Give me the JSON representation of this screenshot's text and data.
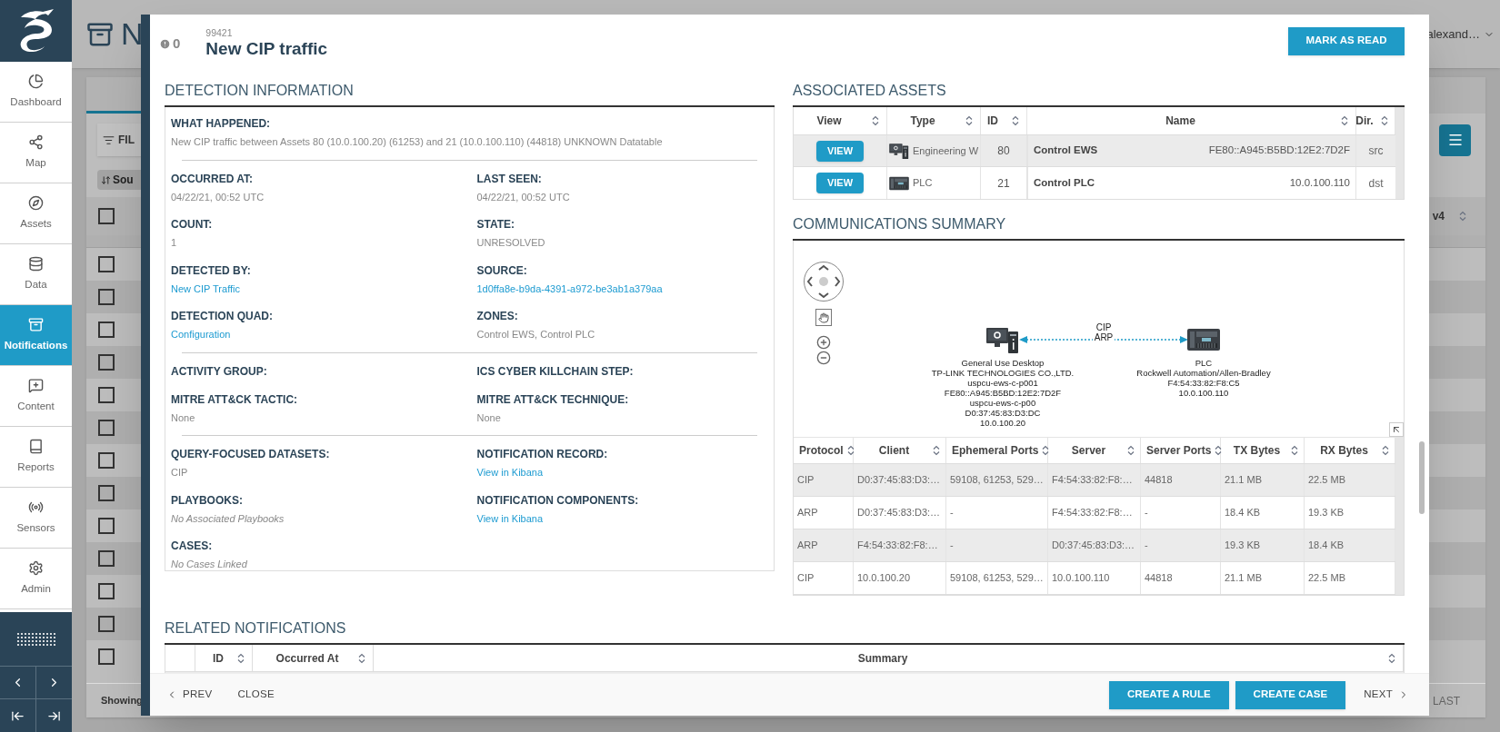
{
  "sidebar": {
    "items": [
      {
        "label": "Dashboard",
        "selected": false
      },
      {
        "label": "Map",
        "selected": false
      },
      {
        "label": "Assets",
        "selected": false
      },
      {
        "label": "Data",
        "selected": false
      },
      {
        "label": "Notifications",
        "selected": true
      },
      {
        "label": "Content",
        "selected": false
      },
      {
        "label": "Reports",
        "selected": false
      },
      {
        "label": "Sensors",
        "selected": false
      },
      {
        "label": "Admin",
        "selected": false
      }
    ]
  },
  "background": {
    "title": "N",
    "user": "alexand…",
    "filter_button": "FIL",
    "chip": "Sou",
    "column_header": "v4",
    "footer_text": "Showing",
    "last_button": "LAST",
    "header_checkbox": {
      "checked": false
    },
    "row_checkboxes": [
      {
        "checked": false
      },
      {
        "checked": false
      },
      {
        "checked": false
      },
      {
        "checked": false
      },
      {
        "checked": false
      },
      {
        "checked": false
      },
      {
        "checked": false
      },
      {
        "checked": false
      },
      {
        "checked": false
      },
      {
        "checked": false
      },
      {
        "checked": false
      },
      {
        "checked": false
      },
      {
        "checked": false
      }
    ]
  },
  "dialog": {
    "unread_count": "0",
    "id": "99421",
    "title": "New CIP traffic",
    "mark_read_button": "MARK AS READ",
    "detection": {
      "heading": "DETECTION INFORMATION",
      "groups": [
        {
          "fields": [
            {
              "label": "WHAT HAPPENED:",
              "value": "New CIP traffic between Assets 80 (10.0.100.20) (61253) and 21 (10.0.100.110) (44818) UNKNOWN Datatable",
              "kind": "text",
              "wide": true
            }
          ]
        },
        {
          "fields": [
            {
              "label": "OCCURRED AT:",
              "value": "04/22/21, 00:52 UTC",
              "kind": "text"
            },
            {
              "label": "LAST SEEN:",
              "value": "04/22/21, 00:52 UTC",
              "kind": "text"
            },
            {
              "label": "COUNT:",
              "value": "1",
              "kind": "text"
            },
            {
              "label": "STATE:",
              "value": "UNRESOLVED",
              "kind": "text"
            },
            {
              "label": "DETECTED BY:",
              "value": "New CIP Traffic",
              "kind": "link"
            },
            {
              "label": "SOURCE:",
              "value": "1d0ffa8e-b9da-4391-a972-be3ab1a379aa",
              "kind": "link"
            },
            {
              "label": "DETECTION QUAD:",
              "value": "Configuration",
              "kind": "link"
            },
            {
              "label": "ZONES:",
              "value": "Control EWS, Control PLC",
              "kind": "text"
            }
          ]
        },
        {
          "fields": [
            {
              "label": "ACTIVITY GROUP:"
            },
            {
              "label": "ICS CYBER KILLCHAIN STEP:"
            },
            {
              "label": "MITRE ATT&CK TACTIC:",
              "value": "None",
              "kind": "text"
            },
            {
              "label": "MITRE ATT&CK TECHNIQUE:",
              "value": "None",
              "kind": "text"
            }
          ]
        },
        {
          "fields": [
            {
              "label": "QUERY-FOCUSED DATASETS:",
              "value": "CIP",
              "kind": "text"
            },
            {
              "label": "NOTIFICATION RECORD:",
              "value": "View in Kibana",
              "kind": "link"
            },
            {
              "label": "PLAYBOOKS:",
              "value": "No Associated Playbooks",
              "kind": "italic"
            },
            {
              "label": "NOTIFICATION COMPONENTS:",
              "value": "View in Kibana",
              "kind": "link"
            },
            {
              "label": "CASES:",
              "value": "No Cases Linked",
              "kind": "italic"
            }
          ]
        }
      ]
    },
    "associated_assets": {
      "heading": "ASSOCIATED ASSETS",
      "columns": [
        "View",
        "Type",
        "ID",
        "Name",
        "Dir."
      ],
      "rows": [
        {
          "button": "VIEW",
          "kind": "workstation",
          "type": "Engineering W",
          "id": "80",
          "name": "Control EWS",
          "address": "FE80::A945:B5BD:12E2:7D2F",
          "dir": "src"
        },
        {
          "button": "VIEW",
          "kind": "plc",
          "type": "PLC",
          "id": "21",
          "name": "Control PLC",
          "address": "10.0.100.110",
          "dir": "dst"
        }
      ]
    },
    "communications": {
      "heading": "COMMUNICATIONS SUMMARY",
      "graph": {
        "nodes": [
          {
            "kind": "workstation",
            "lines": [
              "General Use Desktop",
              "TP-LINK TECHNOLOGIES CO.,LTD.",
              "uspcu-ews-c-p001",
              "FE80::A945:B5BD:12E2:7D2F",
              "uspcu-ews-c-p00",
              "D0:37:45:83:D3:DC",
              "10.0.100.20"
            ]
          },
          {
            "kind": "plc",
            "lines": [
              "PLC",
              "Rockwell Automation/Allen-Bradley",
              "F4:54:33:82:F8:C5",
              "10.0.100.110"
            ]
          }
        ],
        "edge_labels": [
          "CIP",
          "ARP"
        ]
      },
      "columns": [
        "Protocol",
        "Client",
        "Ephemeral Ports",
        "Server",
        "Server Ports",
        "TX Bytes",
        "RX Bytes"
      ],
      "rows": [
        [
          "CIP",
          "D0:37:45:83:D3:…",
          "59108, 61253, 529…",
          "F4:54:33:82:F8:…",
          "44818",
          "21.1 MB",
          "22.5 MB"
        ],
        [
          "ARP",
          "D0:37:45:83:D3:…",
          "-",
          "F4:54:33:82:F8:…",
          "-",
          "18.4 KB",
          "19.3 KB"
        ],
        [
          "ARP",
          "F4:54:33:82:F8:…",
          "-",
          "D0:37:45:83:D3:…",
          "-",
          "19.3 KB",
          "18.4 KB"
        ],
        [
          "CIP",
          "10.0.100.20",
          "59108, 61253, 529…",
          "10.0.100.110",
          "44818",
          "21.1 MB",
          "22.5 MB"
        ]
      ]
    },
    "related": {
      "heading": "RELATED NOTIFICATIONS",
      "columns": [
        "ID",
        "Occurred At",
        "Summary"
      ]
    },
    "footer": {
      "prev": "PREV",
      "close": "CLOSE",
      "actions": [
        "CREATE A RULE",
        "CREATE CASE"
      ],
      "next": "NEXT"
    }
  }
}
